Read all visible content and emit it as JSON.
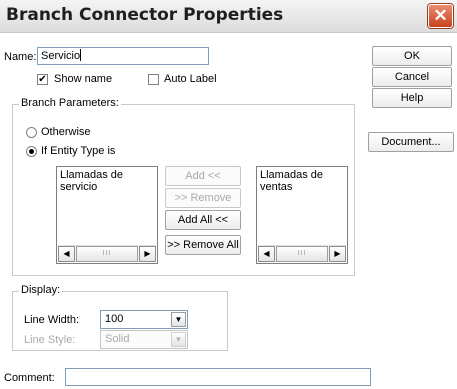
{
  "window": {
    "title": "Branch Connector Properties",
    "close_glyph": "✕"
  },
  "name_field": {
    "label": "Name:",
    "value": "Servicio"
  },
  "show_name": {
    "label": "Show name",
    "checked": true
  },
  "auto_label": {
    "label": "Auto Label",
    "checked": false
  },
  "side_buttons": {
    "ok": "OK",
    "cancel": "Cancel",
    "help": "Help",
    "document": "Document..."
  },
  "branch_params": {
    "legend": "Branch Parameters:",
    "otherwise": {
      "label": "Otherwise",
      "selected": false
    },
    "if_entity": {
      "label": "If Entity Type is",
      "selected": true
    },
    "left_list": [
      "Llamadas de servicio"
    ],
    "right_list": [
      "Llamadas de ventas"
    ],
    "buttons": {
      "add": "Add   <<",
      "remove": ">> Remove",
      "add_all": "Add All  <<",
      "remove_all": ">> Remove All"
    },
    "scroll_thumb": "III",
    "scroll_left": "◀",
    "scroll_right": "▶"
  },
  "display": {
    "legend": "Display:",
    "line_width": {
      "label": "Line Width:",
      "value": "100"
    },
    "line_style": {
      "label": "Line Style:",
      "value": "Solid"
    },
    "dropdown_arrow": "▼"
  },
  "comment": {
    "label": "Comment:",
    "value": ""
  }
}
